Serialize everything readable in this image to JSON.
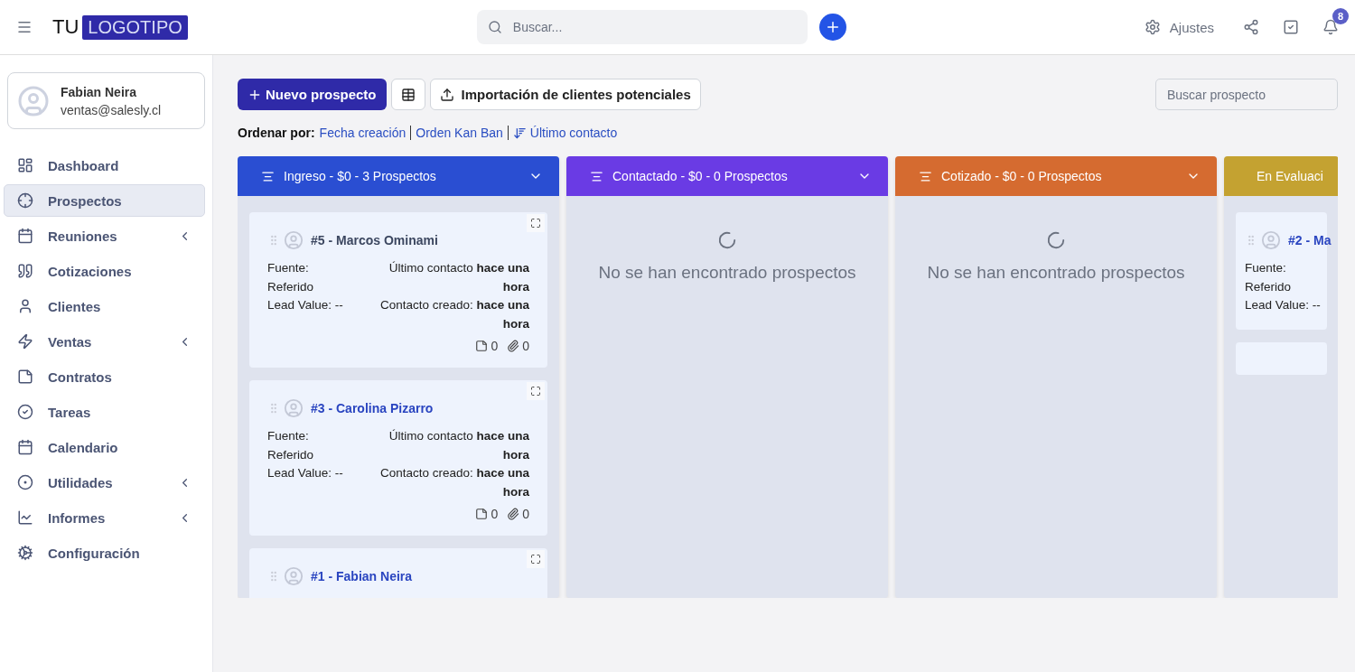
{
  "topbar": {
    "logo": {
      "prefix": "TU",
      "boxed": "LOGOTIPO"
    },
    "search": {
      "placeholder": "Buscar..."
    },
    "settings_label": "Ajustes",
    "notifications_count": "8"
  },
  "sidebar": {
    "user": {
      "name": "Fabian Neira",
      "email": "ventas@salesly.cl"
    },
    "items": [
      {
        "label": "Dashboard",
        "selected": false,
        "expandable": false
      },
      {
        "label": "Prospectos",
        "selected": true,
        "expandable": false
      },
      {
        "label": "Reuniones",
        "selected": false,
        "expandable": true
      },
      {
        "label": "Cotizaciones",
        "selected": false,
        "expandable": false
      },
      {
        "label": "Clientes",
        "selected": false,
        "expandable": false
      },
      {
        "label": "Ventas",
        "selected": false,
        "expandable": true
      },
      {
        "label": "Contratos",
        "selected": false,
        "expandable": false
      },
      {
        "label": "Tareas",
        "selected": false,
        "expandable": false
      },
      {
        "label": "Calendario",
        "selected": false,
        "expandable": false
      },
      {
        "label": "Utilidades",
        "selected": false,
        "expandable": true
      },
      {
        "label": "Informes",
        "selected": false,
        "expandable": true
      },
      {
        "label": "Configuración",
        "selected": false,
        "expandable": false
      }
    ]
  },
  "toolbar": {
    "new_button": "Nuevo prospecto",
    "import_button": "Importación de clientes potenciales",
    "search": {
      "placeholder": "Buscar prospecto"
    }
  },
  "sort": {
    "label": "Ordenar por:",
    "options": [
      {
        "label": "Fecha creación",
        "active": false
      },
      {
        "label": "Orden Kan Ban",
        "active": false
      },
      {
        "label": "Último contacto",
        "active": true
      }
    ]
  },
  "columns": [
    {
      "title": "Ingreso - $0 - 3 Prospectos",
      "color": "#2a4ed2",
      "has_toggle": true,
      "cards": [
        {
          "kind": "full",
          "title": "#5 - Marcos Ominami",
          "hovered": true,
          "source_label": "Fuente:",
          "source": "Referido",
          "lead_value": "Lead Value: --",
          "last_contact_label": "Último contacto",
          "last_contact": "hace una hora",
          "created_label": "Contacto creado:",
          "created": "hace una hora",
          "notes": "0",
          "attachments": "0"
        },
        {
          "kind": "full",
          "title": "#3 - Carolina Pizarro",
          "hovered": false,
          "source_label": "Fuente:",
          "source": "Referido",
          "lead_value": "Lead Value: --",
          "last_contact_label": "Último contacto",
          "last_contact": "hace una hora",
          "created_label": "Contacto creado:",
          "created": "hace una hora",
          "notes": "0",
          "attachments": "0"
        },
        {
          "kind": "header",
          "title": "#1 - Fabian Neira",
          "hovered": false
        }
      ]
    },
    {
      "title": "Contactado - $0 - 0 Prospectos",
      "color": "#6a3be4",
      "has_toggle": true,
      "empty_text": "No se han encontrado prospectos"
    },
    {
      "title": "Cotizado - $0 - 0 Prospectos",
      "color": "#d56b30",
      "has_toggle": true,
      "empty_text": "No se han encontrado prospectos"
    },
    {
      "title": "En Evaluaci",
      "color": "#c4a231",
      "has_toggle": false,
      "cards": [
        {
          "kind": "left",
          "title": "#2 - Ma",
          "hovered": false,
          "source_label": "Fuente:",
          "source": "Referido",
          "lead_value": "Lead Value: --"
        },
        {
          "kind": "blank"
        }
      ]
    }
  ]
}
